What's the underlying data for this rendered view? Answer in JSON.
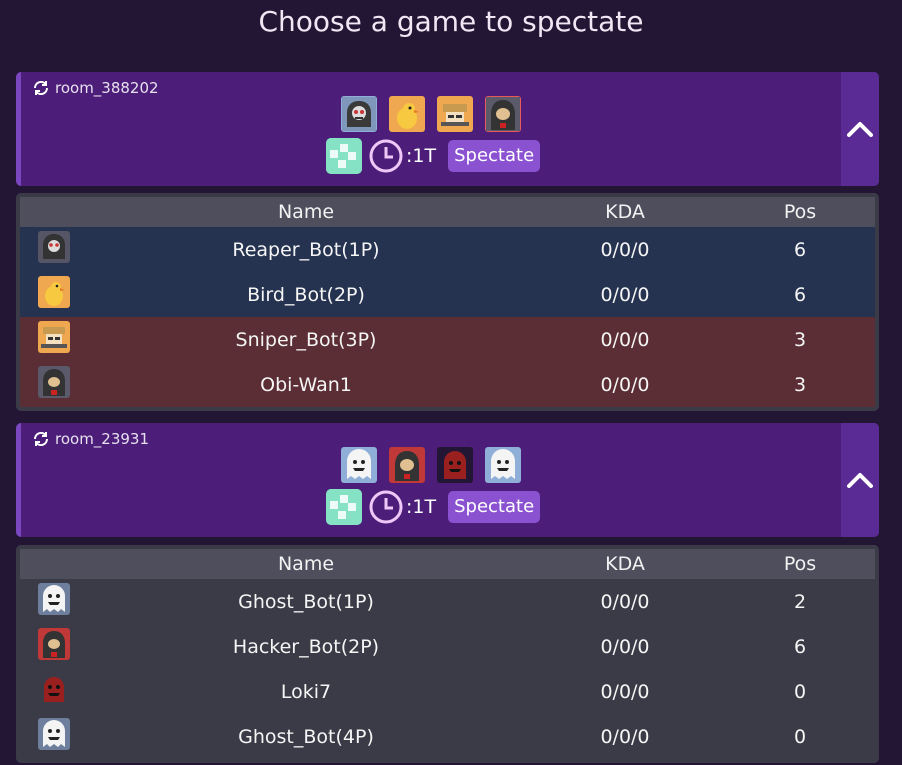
{
  "page": {
    "title": "Choose a game to spectate"
  },
  "rooms": [
    {
      "id": "room_388202",
      "turn_text": ":1T",
      "spectate_label": "Spectate",
      "avatars": [
        "reaper",
        "bird",
        "sniper",
        "obiwan"
      ],
      "table": {
        "headers": {
          "name": "Name",
          "kda": "KDA",
          "pos": "Pos"
        },
        "rows": [
          {
            "avatar": "reaper",
            "name": "Reaper_Bot(1P)",
            "kda": "0/0/0",
            "pos": "6",
            "team": "a"
          },
          {
            "avatar": "bird",
            "name": "Bird_Bot(2P)",
            "kda": "0/0/0",
            "pos": "6",
            "team": "a"
          },
          {
            "avatar": "sniper",
            "name": "Sniper_Bot(3P)",
            "kda": "0/0/0",
            "pos": "3",
            "team": "b"
          },
          {
            "avatar": "obiwan",
            "name": "Obi-Wan1",
            "kda": "0/0/0",
            "pos": "3",
            "team": "b"
          }
        ]
      }
    },
    {
      "id": "room_23931",
      "turn_text": ":1T",
      "spectate_label": "Spectate",
      "avatars": [
        "ghost",
        "hacker",
        "loki",
        "ghost"
      ],
      "table": {
        "headers": {
          "name": "Name",
          "kda": "KDA",
          "pos": "Pos"
        },
        "rows": [
          {
            "avatar": "ghost",
            "name": "Ghost_Bot(1P)",
            "kda": "0/0/0",
            "pos": "2",
            "team": "neutral"
          },
          {
            "avatar": "hacker",
            "name": "Hacker_Bot(2P)",
            "kda": "0/0/0",
            "pos": "6",
            "team": "neutral"
          },
          {
            "avatar": "loki",
            "name": "Loki7",
            "kda": "0/0/0",
            "pos": "0",
            "team": "neutral"
          },
          {
            "avatar": "ghost",
            "name": "Ghost_Bot(4P)",
            "kda": "0/0/0",
            "pos": "0",
            "team": "neutral"
          }
        ]
      }
    }
  ],
  "icons": {
    "refresh": "refresh-icon",
    "map": "map-icon",
    "clock": "clock-icon",
    "collapse": "chevron-up-icon"
  }
}
